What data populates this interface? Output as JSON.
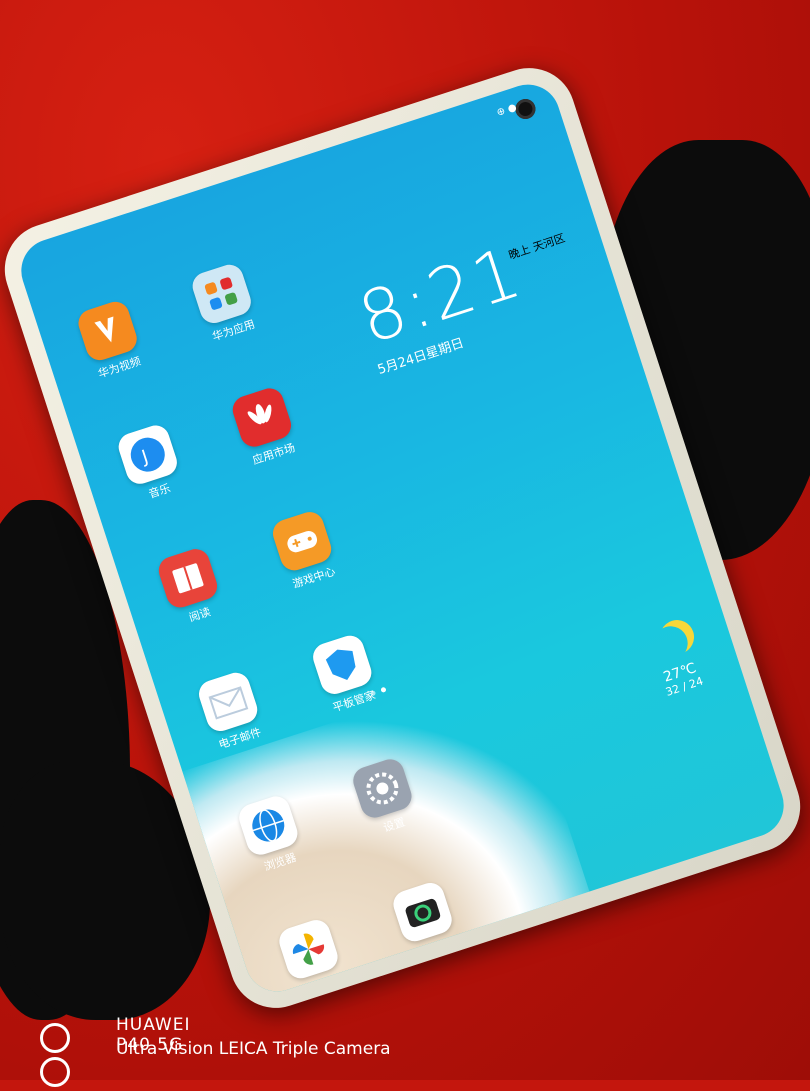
{
  "status_bar": {
    "indicators": "⊕ ●"
  },
  "clock": {
    "time": "8:21",
    "date": "5月24日星期日",
    "location": "晚上 天河区"
  },
  "weather": {
    "icon": "moon-icon",
    "temp": "27℃",
    "range": "32 / 24"
  },
  "apps": [
    {
      "name": "huawei-video",
      "label": "华为视频",
      "icon": "video-icon",
      "color": "#f58a1f"
    },
    {
      "name": "huawei-apps-folder",
      "label": "华为应用",
      "icon": "folder-icon",
      "color": "#cfe8f5"
    },
    {
      "name": "music",
      "label": "音乐",
      "icon": "music-icon",
      "color": "#ffffff"
    },
    {
      "name": "app-market",
      "label": "应用市场",
      "icon": "huawei-logo-icon",
      "color": "#e12d2d"
    },
    {
      "name": "reading",
      "label": "阅读",
      "icon": "book-icon",
      "color": "#e8443a"
    },
    {
      "name": "game-center",
      "label": "游戏中心",
      "icon": "gamepad-icon",
      "color": "#f59a26"
    },
    {
      "name": "email",
      "label": "电子邮件",
      "icon": "mail-icon",
      "color": "#ffffff"
    },
    {
      "name": "tablet-manager",
      "label": "平板管家",
      "icon": "shield-icon",
      "color": "#ffffff"
    },
    {
      "name": "browser",
      "label": "浏览器",
      "icon": "globe-icon",
      "color": "#ffffff"
    },
    {
      "name": "settings",
      "label": "设置",
      "icon": "gear-icon",
      "color": "#9aa3b0"
    },
    {
      "name": "gallery",
      "label": "图库",
      "icon": "pinwheel-icon",
      "color": "#ffffff"
    },
    {
      "name": "camera",
      "label": "相机",
      "icon": "camera-icon",
      "color": "#ffffff"
    }
  ],
  "watermark": {
    "line1": "HUAWEI P40 5G",
    "line2": "Ultra Vision LEICA Triple Camera"
  }
}
